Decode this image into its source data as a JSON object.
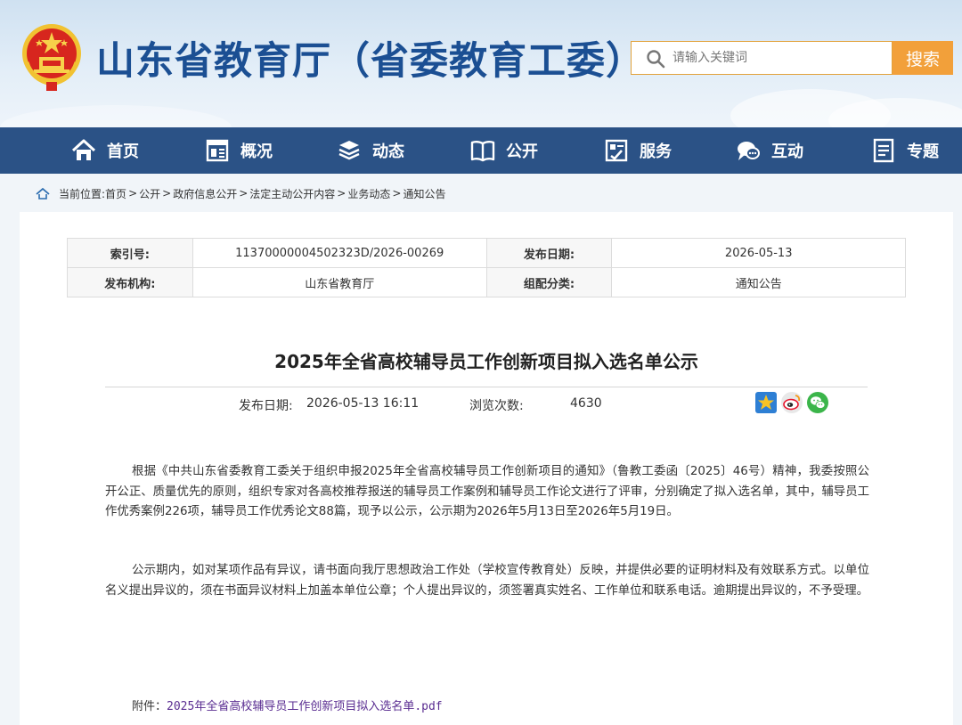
{
  "header": {
    "site_title": "山东省教育厅（省委教育工委）",
    "search_placeholder": "请输入关键词",
    "search_button": "搜索",
    "colors": {
      "title_blue": "#1b4f93",
      "search_orange": "#f2a03a",
      "nav_blue": "#2b5286"
    }
  },
  "nav": {
    "items": [
      {
        "label": "首页",
        "icon": "home-icon"
      },
      {
        "label": "概况",
        "icon": "overview-icon"
      },
      {
        "label": "动态",
        "icon": "news-icon"
      },
      {
        "label": "公开",
        "icon": "book-icon"
      },
      {
        "label": "服务",
        "icon": "service-icon"
      },
      {
        "label": "互动",
        "icon": "chat-icon"
      },
      {
        "label": "专题",
        "icon": "document-icon"
      }
    ]
  },
  "breadcrumb": {
    "prefix": "当前位置:",
    "items": [
      "首页",
      "公开",
      "政府信息公开",
      "法定主动公开内容",
      "业务动态",
      "通知公告"
    ]
  },
  "meta": {
    "index_label": "索引号:",
    "index_value": "11370000004502323D/2026-00269",
    "date_label": "发布日期:",
    "date_value": "2026-05-13",
    "org_label": "发布机构:",
    "org_value": "山东省教育厅",
    "category_label": "组配分类:",
    "category_value": "通知公告"
  },
  "article": {
    "title": "2025年全省高校辅导员工作创新项目拟入选名单公示",
    "publish_label": "发布日期:",
    "publish_value": "2026-05-13 16:11",
    "views_label": "浏览次数:",
    "views_value": "4630",
    "share_icons": [
      "qzone-star-icon",
      "weibo-icon",
      "wechat-icon"
    ],
    "paragraphs": [
      "根据《中共山东省委教育工委关于组织申报2025年全省高校辅导员工作创新项目的通知》（鲁教工委函〔2025〕46号）精神，我委按照公开公正、质量优先的原则，组织专家对各高校推荐报送的辅导员工作案例和辅导员工作论文进行了评审，分别确定了拟入选名单，其中，辅导员工作优秀案例226项，辅导员工作优秀论文88篇，现予以公示，公示期为2026年5月13日至2026年5月19日。",
      "公示期内，如对某项作品有异议，请书面向我厅思想政治工作处（学校宣传教育处）反映，并提供必要的证明材料及有效联系方式。以单位名义提出异议的，须在书面异议材料上加盖本单位公章；个人提出异议的，须签署真实姓名、工作单位和联系电话。逾期提出异议的，不予受理。"
    ],
    "attachment_label": "附件：",
    "attachment_link": "2025年全省高校辅导员工作创新项目拟入选名单.pdf"
  }
}
